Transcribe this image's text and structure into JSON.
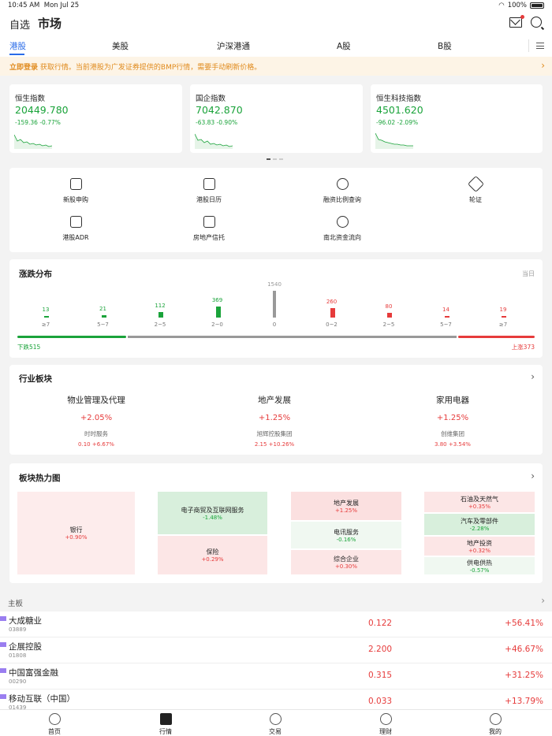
{
  "status": {
    "time": "10:45 AM",
    "date": "Mon Jul 25",
    "battery": "100%"
  },
  "header": {
    "watchlist": "自选",
    "market": "市场"
  },
  "tabs": [
    "港股",
    "美股",
    "沪深港通",
    "A股",
    "B股"
  ],
  "notice": {
    "link": "立即登录",
    "text": "获取行情。当前港股为广发证券提供的BMP行情，需要手动刷新价格。"
  },
  "indices": [
    {
      "name": "恒生指数",
      "value": "20449.780",
      "change": "-159.36 -0.77%"
    },
    {
      "name": "国企指数",
      "value": "7042.870",
      "change": "-63.83 -0.90%"
    },
    {
      "name": "恒生科技指数",
      "value": "4501.620",
      "change": "-96.02 -2.09%"
    }
  ],
  "tools": [
    {
      "label": "新股申购",
      "icon": "ipo-bag-icon"
    },
    {
      "label": "港股日历",
      "icon": "calendar-icon"
    },
    {
      "label": "融资比例查询",
      "icon": "search-circle-icon"
    },
    {
      "label": "轮证",
      "icon": "warrant-icon"
    },
    {
      "label": "港股ADR",
      "icon": "adr-icon"
    },
    {
      "label": "房地产信托",
      "icon": "reit-house-icon"
    },
    {
      "label": "南北资金流向",
      "icon": "capital-flow-icon"
    }
  ],
  "distribution": {
    "title": "涨跌分布",
    "period": "当日",
    "buckets": [
      {
        "count": "13",
        "label": "≥7",
        "kind": "down"
      },
      {
        "count": "21",
        "label": "5~7",
        "kind": "down"
      },
      {
        "count": "112",
        "label": "2~5",
        "kind": "down"
      },
      {
        "count": "369",
        "label": "2~0",
        "kind": "down"
      },
      {
        "count": "1540",
        "label": "0",
        "kind": "flat"
      },
      {
        "count": "260",
        "label": "0~2",
        "kind": "up"
      },
      {
        "count": "80",
        "label": "2~5",
        "kind": "up"
      },
      {
        "count": "14",
        "label": "5~7",
        "kind": "up"
      },
      {
        "count": "19",
        "label": "≥7",
        "kind": "up"
      }
    ],
    "down_total": "下跌515",
    "up_total": "上涨373"
  },
  "industry": {
    "title": "行业板块",
    "items": [
      {
        "name": "物业管理及代理",
        "pct": "+2.05%",
        "stock": "时时服务",
        "stock_change": "0.10 +6.67%"
      },
      {
        "name": "地产发展",
        "pct": "+1.25%",
        "stock": "旭辉控股集团",
        "stock_change": "2.15 +10.26%"
      },
      {
        "name": "家用电器",
        "pct": "+1.25%",
        "stock": "创维集团",
        "stock_change": "3.80 +3.54%"
      }
    ]
  },
  "heatmap": {
    "title": "板块热力图",
    "cells": [
      {
        "name": "银行",
        "pct": "+0.90%"
      },
      {
        "name": "电子商贸及互联网服务",
        "pct": "-1.48%"
      },
      {
        "name": "保险",
        "pct": "+0.29%"
      },
      {
        "name": "地产发展",
        "pct": "+1.25%"
      },
      {
        "name": "电讯服务",
        "pct": "-0.16%"
      },
      {
        "name": "综合企业",
        "pct": "+0.30%"
      },
      {
        "name": "石油及天然气",
        "pct": "+0.35%"
      },
      {
        "name": "汽车及零部件",
        "pct": "-2.28%"
      },
      {
        "name": "地产投资",
        "pct": "+0.32%"
      },
      {
        "name": "供电供热",
        "pct": "-0.57%"
      }
    ]
  },
  "board": {
    "title": "主板",
    "rows": [
      {
        "name": "大成糖业",
        "code": "03889",
        "price": "0.122",
        "change": "+56.41%"
      },
      {
        "name": "企展控股",
        "code": "01808",
        "price": "2.200",
        "change": "+46.67%"
      },
      {
        "name": "中国富强金融",
        "code": "00290",
        "price": "0.315",
        "change": "+31.25%"
      },
      {
        "name": "移动互联（中国）",
        "code": "01439",
        "price": "0.033",
        "change": "+13.79%"
      }
    ]
  },
  "nav": [
    "首页",
    "行情",
    "交易",
    "理财",
    "我的"
  ]
}
